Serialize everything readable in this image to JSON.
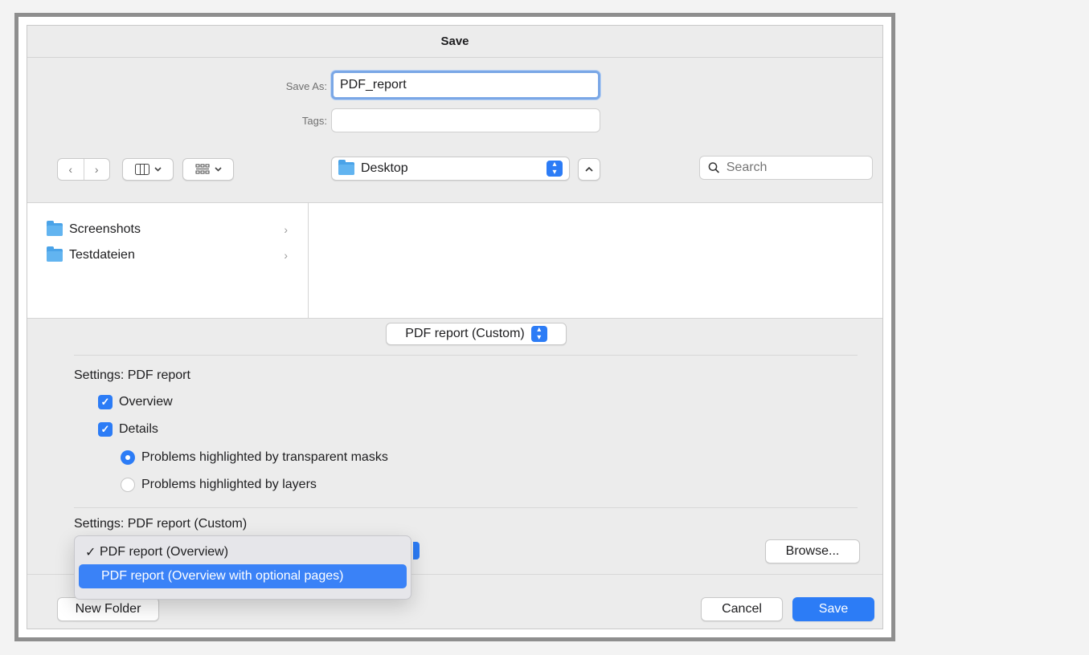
{
  "dialog": {
    "title": "Save",
    "save_as_label": "Save As:",
    "save_as_value": "PDF_report",
    "tags_label": "Tags:",
    "tags_value": ""
  },
  "toolbar": {
    "back_icon": "chevron-left-icon",
    "forward_icon": "chevron-right-icon",
    "column_view_icon": "columns-icon",
    "group_icon": "grid-icon",
    "location": "Desktop",
    "search_placeholder": "Search"
  },
  "browser": {
    "items": [
      {
        "label": "Screenshots"
      },
      {
        "label": "Testdateien"
      }
    ]
  },
  "format": {
    "selected": "PDF report (Custom)"
  },
  "settings": {
    "title": "Settings: PDF report",
    "overview_label": "Overview",
    "overview_checked": true,
    "details_label": "Details",
    "details_checked": true,
    "radio1_label": "Problems highlighted by transparent masks",
    "radio1_selected": true,
    "radio2_label": "Problems highlighted by layers",
    "radio2_selected": false,
    "custom_title": "Settings: PDF report (Custom)",
    "browse_label": "Browse..."
  },
  "dropdown": {
    "options": [
      {
        "label": "PDF report (Overview)",
        "checked": true,
        "highlighted": false
      },
      {
        "label": "PDF report (Overview with optional pages)",
        "checked": false,
        "highlighted": true
      }
    ]
  },
  "footer": {
    "new_folder": "New Folder",
    "cancel": "Cancel",
    "save": "Save"
  },
  "colors": {
    "accent": "#2c7cf6",
    "highlight": "#3a82f7"
  }
}
